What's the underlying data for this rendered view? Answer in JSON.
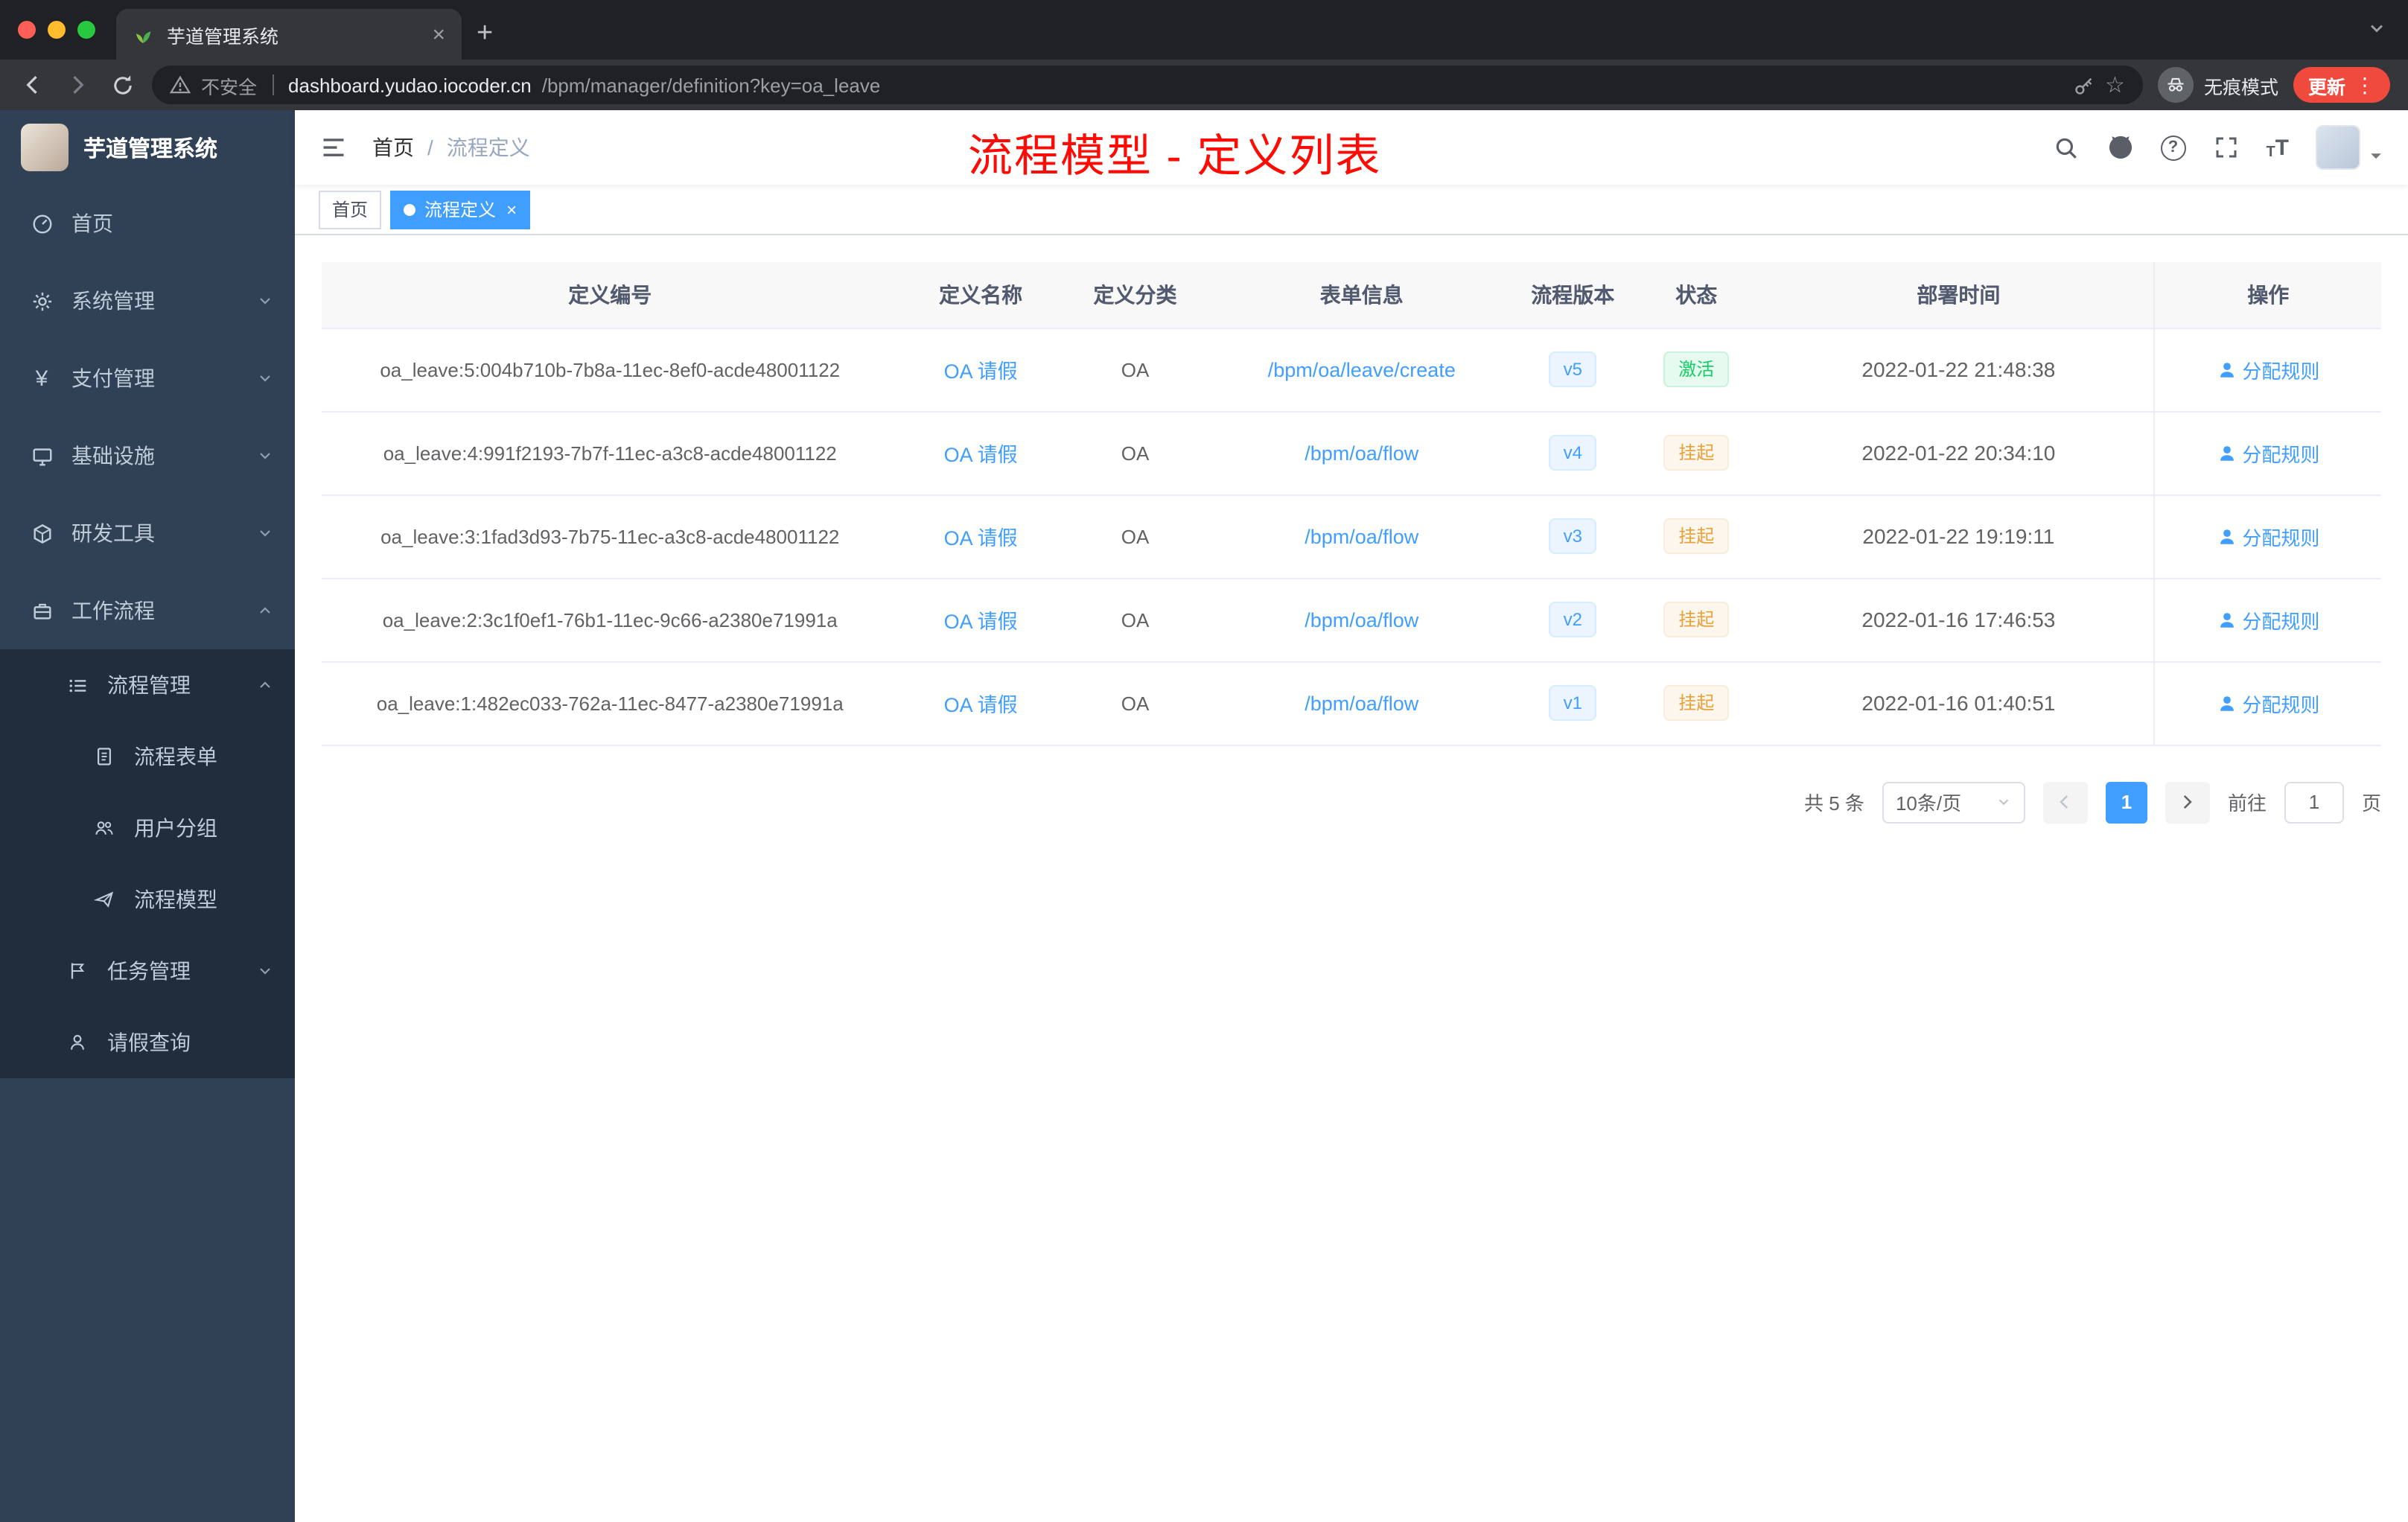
{
  "browser": {
    "tab_title": "芋道管理系统",
    "security_label": "不安全",
    "url_host": "dashboard.yudao.iocoder.cn",
    "url_path": "/bpm/manager/definition?key=oa_leave",
    "incognito_label": "无痕模式",
    "update_label": "更新"
  },
  "icons": {
    "close": "×",
    "new_tab": "+",
    "star": "☆",
    "kebab": "⋮",
    "question": "?",
    "yen": "¥",
    "font_size": "T"
  },
  "sidebar": {
    "app_title": "芋道管理系统",
    "items": [
      {
        "label": "首页"
      },
      {
        "label": "系统管理"
      },
      {
        "label": "支付管理"
      },
      {
        "label": "基础设施"
      },
      {
        "label": "研发工具"
      },
      {
        "label": "工作流程"
      }
    ],
    "submenu": [
      {
        "label": "流程管理"
      },
      {
        "label": "流程表单"
      },
      {
        "label": "用户分组"
      },
      {
        "label": "流程模型"
      },
      {
        "label": "任务管理"
      },
      {
        "label": "请假查询"
      }
    ]
  },
  "header": {
    "breadcrumb_home": "首页",
    "breadcrumb_sep": "/",
    "breadcrumb_current": "流程定义",
    "annotation": "流程模型 - 定义列表"
  },
  "tags": {
    "home": "首页",
    "current": "流程定义"
  },
  "table": {
    "columns": [
      "定义编号",
      "定义名称",
      "定义分类",
      "表单信息",
      "流程版本",
      "状态",
      "部署时间",
      "操作"
    ],
    "rows": [
      {
        "id": "oa_leave:5:004b710b-7b8a-11ec-8ef0-acde48001122",
        "name": "OA 请假",
        "category": "OA",
        "form": "/bpm/oa/leave/create",
        "version": "v5",
        "status": "激活",
        "time": "2022-01-22 21:48:38",
        "action": "分配规则"
      },
      {
        "id": "oa_leave:4:991f2193-7b7f-11ec-a3c8-acde48001122",
        "name": "OA 请假",
        "category": "OA",
        "form": "/bpm/oa/flow",
        "version": "v4",
        "status": "挂起",
        "time": "2022-01-22 20:34:10",
        "action": "分配规则"
      },
      {
        "id": "oa_leave:3:1fad3d93-7b75-11ec-a3c8-acde48001122",
        "name": "OA 请假",
        "category": "OA",
        "form": "/bpm/oa/flow",
        "version": "v3",
        "status": "挂起",
        "time": "2022-01-22 19:19:11",
        "action": "分配规则"
      },
      {
        "id": "oa_leave:2:3c1f0ef1-76b1-11ec-9c66-a2380e71991a",
        "name": "OA 请假",
        "category": "OA",
        "form": "/bpm/oa/flow",
        "version": "v2",
        "status": "挂起",
        "time": "2022-01-16 17:46:53",
        "action": "分配规则"
      },
      {
        "id": "oa_leave:1:482ec033-762a-11ec-8477-a2380e71991a",
        "name": "OA 请假",
        "category": "OA",
        "form": "/bpm/oa/flow",
        "version": "v1",
        "status": "挂起",
        "time": "2022-01-16 01:40:51",
        "action": "分配规则"
      }
    ]
  },
  "pagination": {
    "total": "共 5 条",
    "size": "10条/页",
    "page": "1",
    "goto": "前往",
    "unit": "页",
    "goto_value": "1"
  }
}
